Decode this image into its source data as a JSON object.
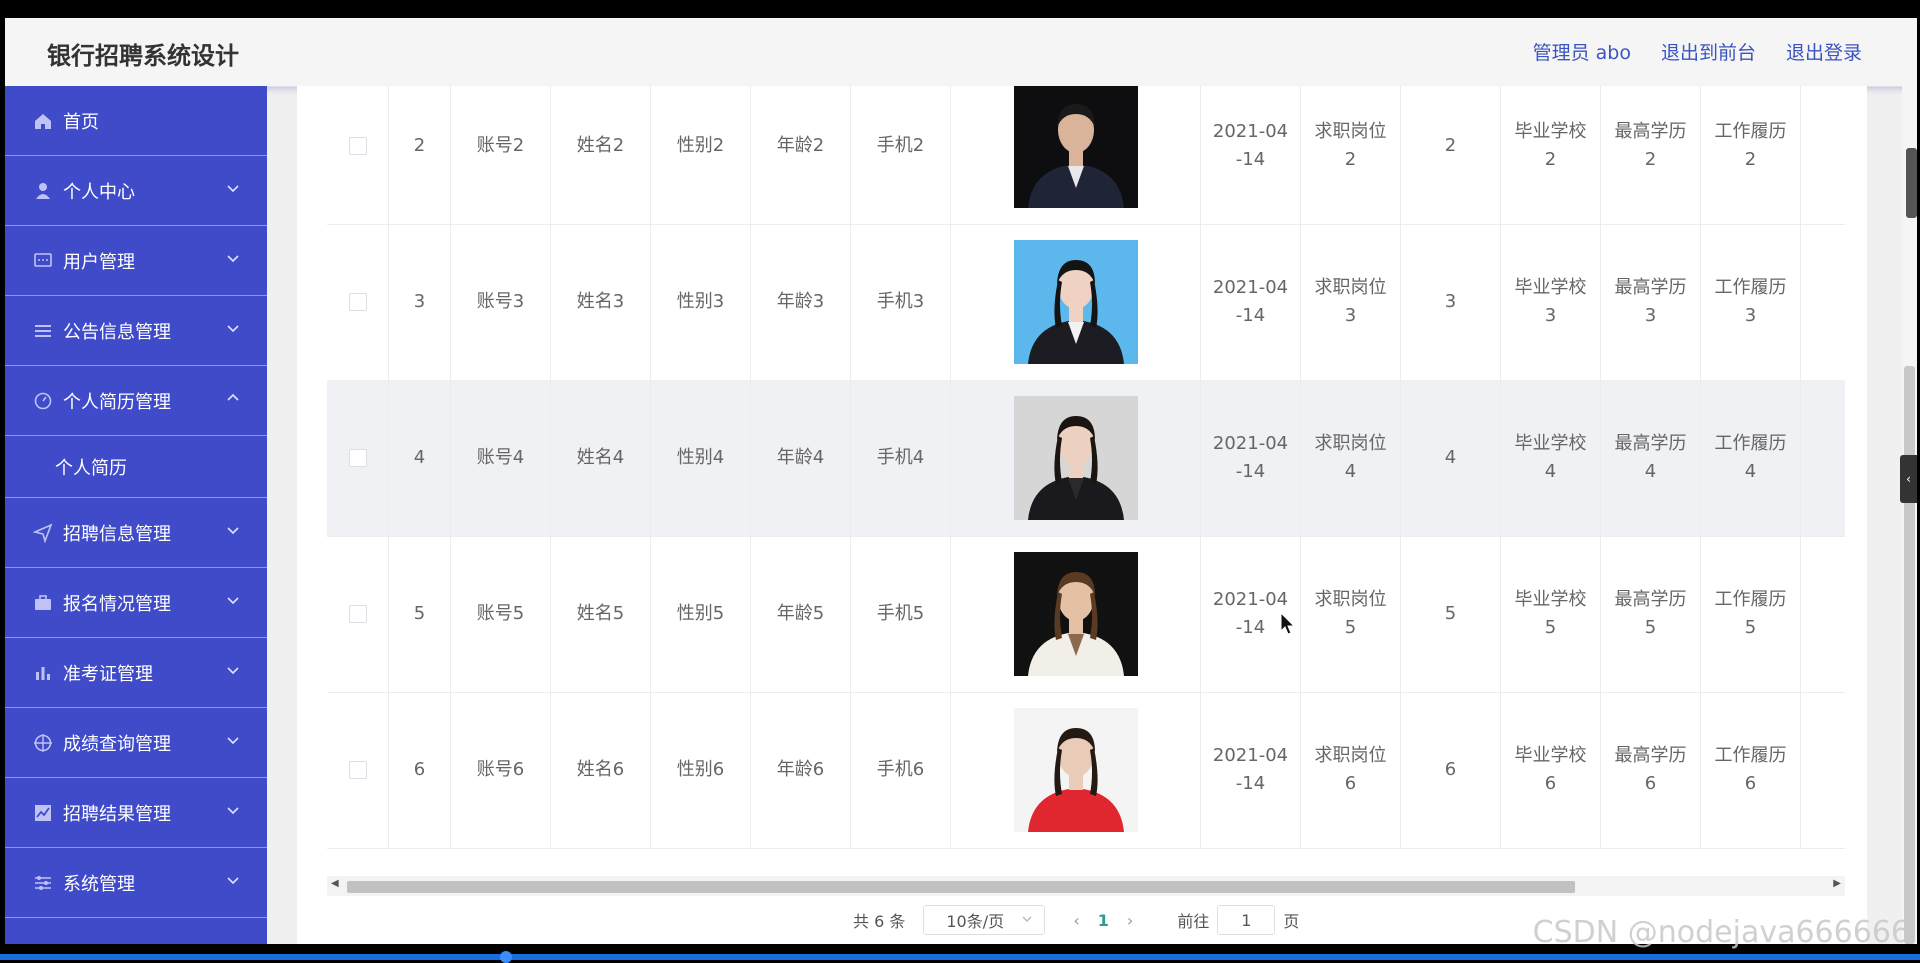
{
  "header": {
    "app_title": "银行招聘系统设计",
    "admin_label": "管理员 abo",
    "to_front_label": "退出到前台",
    "logout_label": "退出登录"
  },
  "sidebar": {
    "items": [
      {
        "label": "首页",
        "icon": "home-icon",
        "expandable": false
      },
      {
        "label": "个人中心",
        "icon": "user-icon",
        "expandable": true
      },
      {
        "label": "用户管理",
        "icon": "chat-icon",
        "expandable": true
      },
      {
        "label": "公告信息管理",
        "icon": "list-icon",
        "expandable": true
      },
      {
        "label": "个人简历管理",
        "icon": "gauge-icon",
        "expandable": true,
        "expanded": true
      },
      {
        "label": "招聘信息管理",
        "icon": "send-icon",
        "expandable": true
      },
      {
        "label": "报名情况管理",
        "icon": "briefcase-icon",
        "expandable": true
      },
      {
        "label": "准考证管理",
        "icon": "bar-chart-icon",
        "expandable": true
      },
      {
        "label": "成绩查询管理",
        "icon": "target-icon",
        "expandable": true
      },
      {
        "label": "招聘结果管理",
        "icon": "line-chart-icon",
        "expandable": true
      },
      {
        "label": "系统管理",
        "icon": "sliders-icon",
        "expandable": true
      }
    ],
    "sub_item": "个人简历"
  },
  "table": {
    "rows": [
      {
        "id": "2",
        "account": "账号2",
        "name": "姓名2",
        "gender": "性别2",
        "age": "年龄2",
        "phone": "手机2",
        "date": "2021-04\n-14",
        "job": "求职岗位\n2",
        "num": "2",
        "school": "毕业学校\n2",
        "degree": "最高学历\n2",
        "work": "工作履历\n2",
        "photo": {
          "bg": "#0e0e10",
          "suit": "#1f2536",
          "skin": "#d9b49a",
          "hair": "#1a1a1a",
          "shirt": "#e8e8e8"
        }
      },
      {
        "id": "3",
        "account": "账号3",
        "name": "姓名3",
        "gender": "性别3",
        "age": "年龄3",
        "phone": "手机3",
        "date": "2021-04\n-14",
        "job": "求职岗位\n3",
        "num": "3",
        "school": "毕业学校\n3",
        "degree": "最高学历\n3",
        "work": "工作履历\n3",
        "photo": {
          "bg": "#5cb8ec",
          "suit": "#1c1c22",
          "skin": "#f0d2c2",
          "hair": "#141414",
          "shirt": "#f2f2f2"
        }
      },
      {
        "id": "4",
        "account": "账号4",
        "name": "姓名4",
        "gender": "性别4",
        "age": "年龄4",
        "phone": "手机4",
        "date": "2021-04\n-14",
        "job": "求职岗位\n4",
        "num": "4",
        "school": "毕业学校\n4",
        "degree": "最高学历\n4",
        "work": "工作履历\n4",
        "photo": {
          "bg": "#d6d6d6",
          "suit": "#1a1a1e",
          "skin": "#ecd0c0",
          "hair": "#1b1512",
          "shirt": "#2a2a2a"
        },
        "highlight": true
      },
      {
        "id": "5",
        "account": "账号5",
        "name": "姓名5",
        "gender": "性别5",
        "age": "年龄5",
        "phone": "手机5",
        "date": "2021-04\n-14",
        "job": "求职岗位\n5",
        "num": "5",
        "school": "毕业学校\n5",
        "degree": "最高学历\n5",
        "work": "工作履历\n5",
        "photo": {
          "bg": "#111111",
          "suit": "#f2efe8",
          "skin": "#e4c0a4",
          "hair": "#5a3a22",
          "shirt": "#8a6a4e"
        }
      },
      {
        "id": "6",
        "account": "账号6",
        "name": "姓名6",
        "gender": "性别6",
        "age": "年龄6",
        "phone": "手机6",
        "date": "2021-04\n-14",
        "job": "求职岗位\n6",
        "num": "6",
        "school": "毕业学校\n6",
        "degree": "最高学历\n6",
        "work": "工作履历\n6",
        "photo": {
          "bg": "#f4f4f4",
          "suit": "#e0262e",
          "skin": "#eacbb8",
          "hair": "#231a14",
          "shirt": "#e0262e"
        }
      }
    ]
  },
  "pagination": {
    "total": "共 6 条",
    "page_size": "10条/页",
    "current_page": "1",
    "goto_label": "前往",
    "goto_value": "1",
    "page_suffix": "页"
  },
  "watermark": "CSDN @nodejava666666",
  "colors": {
    "sidebar": "#3f4bc9",
    "accent": "#3b54c0",
    "page_active": "#2e9e8b"
  }
}
